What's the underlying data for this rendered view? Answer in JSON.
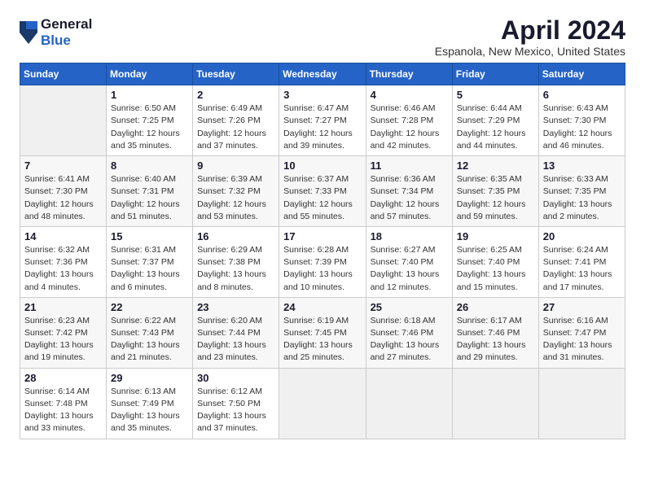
{
  "logo": {
    "general": "General",
    "blue": "Blue"
  },
  "title": "April 2024",
  "location": "Espanola, New Mexico, United States",
  "weekdays": [
    "Sunday",
    "Monday",
    "Tuesday",
    "Wednesday",
    "Thursday",
    "Friday",
    "Saturday"
  ],
  "weeks": [
    [
      {
        "day": "",
        "info": ""
      },
      {
        "day": "1",
        "info": "Sunrise: 6:50 AM\nSunset: 7:25 PM\nDaylight: 12 hours\nand 35 minutes."
      },
      {
        "day": "2",
        "info": "Sunrise: 6:49 AM\nSunset: 7:26 PM\nDaylight: 12 hours\nand 37 minutes."
      },
      {
        "day": "3",
        "info": "Sunrise: 6:47 AM\nSunset: 7:27 PM\nDaylight: 12 hours\nand 39 minutes."
      },
      {
        "day": "4",
        "info": "Sunrise: 6:46 AM\nSunset: 7:28 PM\nDaylight: 12 hours\nand 42 minutes."
      },
      {
        "day": "5",
        "info": "Sunrise: 6:44 AM\nSunset: 7:29 PM\nDaylight: 12 hours\nand 44 minutes."
      },
      {
        "day": "6",
        "info": "Sunrise: 6:43 AM\nSunset: 7:30 PM\nDaylight: 12 hours\nand 46 minutes."
      }
    ],
    [
      {
        "day": "7",
        "info": "Sunrise: 6:41 AM\nSunset: 7:30 PM\nDaylight: 12 hours\nand 48 minutes."
      },
      {
        "day": "8",
        "info": "Sunrise: 6:40 AM\nSunset: 7:31 PM\nDaylight: 12 hours\nand 51 minutes."
      },
      {
        "day": "9",
        "info": "Sunrise: 6:39 AM\nSunset: 7:32 PM\nDaylight: 12 hours\nand 53 minutes."
      },
      {
        "day": "10",
        "info": "Sunrise: 6:37 AM\nSunset: 7:33 PM\nDaylight: 12 hours\nand 55 minutes."
      },
      {
        "day": "11",
        "info": "Sunrise: 6:36 AM\nSunset: 7:34 PM\nDaylight: 12 hours\nand 57 minutes."
      },
      {
        "day": "12",
        "info": "Sunrise: 6:35 AM\nSunset: 7:35 PM\nDaylight: 12 hours\nand 59 minutes."
      },
      {
        "day": "13",
        "info": "Sunrise: 6:33 AM\nSunset: 7:35 PM\nDaylight: 13 hours\nand 2 minutes."
      }
    ],
    [
      {
        "day": "14",
        "info": "Sunrise: 6:32 AM\nSunset: 7:36 PM\nDaylight: 13 hours\nand 4 minutes."
      },
      {
        "day": "15",
        "info": "Sunrise: 6:31 AM\nSunset: 7:37 PM\nDaylight: 13 hours\nand 6 minutes."
      },
      {
        "day": "16",
        "info": "Sunrise: 6:29 AM\nSunset: 7:38 PM\nDaylight: 13 hours\nand 8 minutes."
      },
      {
        "day": "17",
        "info": "Sunrise: 6:28 AM\nSunset: 7:39 PM\nDaylight: 13 hours\nand 10 minutes."
      },
      {
        "day": "18",
        "info": "Sunrise: 6:27 AM\nSunset: 7:40 PM\nDaylight: 13 hours\nand 12 minutes."
      },
      {
        "day": "19",
        "info": "Sunrise: 6:25 AM\nSunset: 7:40 PM\nDaylight: 13 hours\nand 15 minutes."
      },
      {
        "day": "20",
        "info": "Sunrise: 6:24 AM\nSunset: 7:41 PM\nDaylight: 13 hours\nand 17 minutes."
      }
    ],
    [
      {
        "day": "21",
        "info": "Sunrise: 6:23 AM\nSunset: 7:42 PM\nDaylight: 13 hours\nand 19 minutes."
      },
      {
        "day": "22",
        "info": "Sunrise: 6:22 AM\nSunset: 7:43 PM\nDaylight: 13 hours\nand 21 minutes."
      },
      {
        "day": "23",
        "info": "Sunrise: 6:20 AM\nSunset: 7:44 PM\nDaylight: 13 hours\nand 23 minutes."
      },
      {
        "day": "24",
        "info": "Sunrise: 6:19 AM\nSunset: 7:45 PM\nDaylight: 13 hours\nand 25 minutes."
      },
      {
        "day": "25",
        "info": "Sunrise: 6:18 AM\nSunset: 7:46 PM\nDaylight: 13 hours\nand 27 minutes."
      },
      {
        "day": "26",
        "info": "Sunrise: 6:17 AM\nSunset: 7:46 PM\nDaylight: 13 hours\nand 29 minutes."
      },
      {
        "day": "27",
        "info": "Sunrise: 6:16 AM\nSunset: 7:47 PM\nDaylight: 13 hours\nand 31 minutes."
      }
    ],
    [
      {
        "day": "28",
        "info": "Sunrise: 6:14 AM\nSunset: 7:48 PM\nDaylight: 13 hours\nand 33 minutes."
      },
      {
        "day": "29",
        "info": "Sunrise: 6:13 AM\nSunset: 7:49 PM\nDaylight: 13 hours\nand 35 minutes."
      },
      {
        "day": "30",
        "info": "Sunrise: 6:12 AM\nSunset: 7:50 PM\nDaylight: 13 hours\nand 37 minutes."
      },
      {
        "day": "",
        "info": ""
      },
      {
        "day": "",
        "info": ""
      },
      {
        "day": "",
        "info": ""
      },
      {
        "day": "",
        "info": ""
      }
    ]
  ]
}
